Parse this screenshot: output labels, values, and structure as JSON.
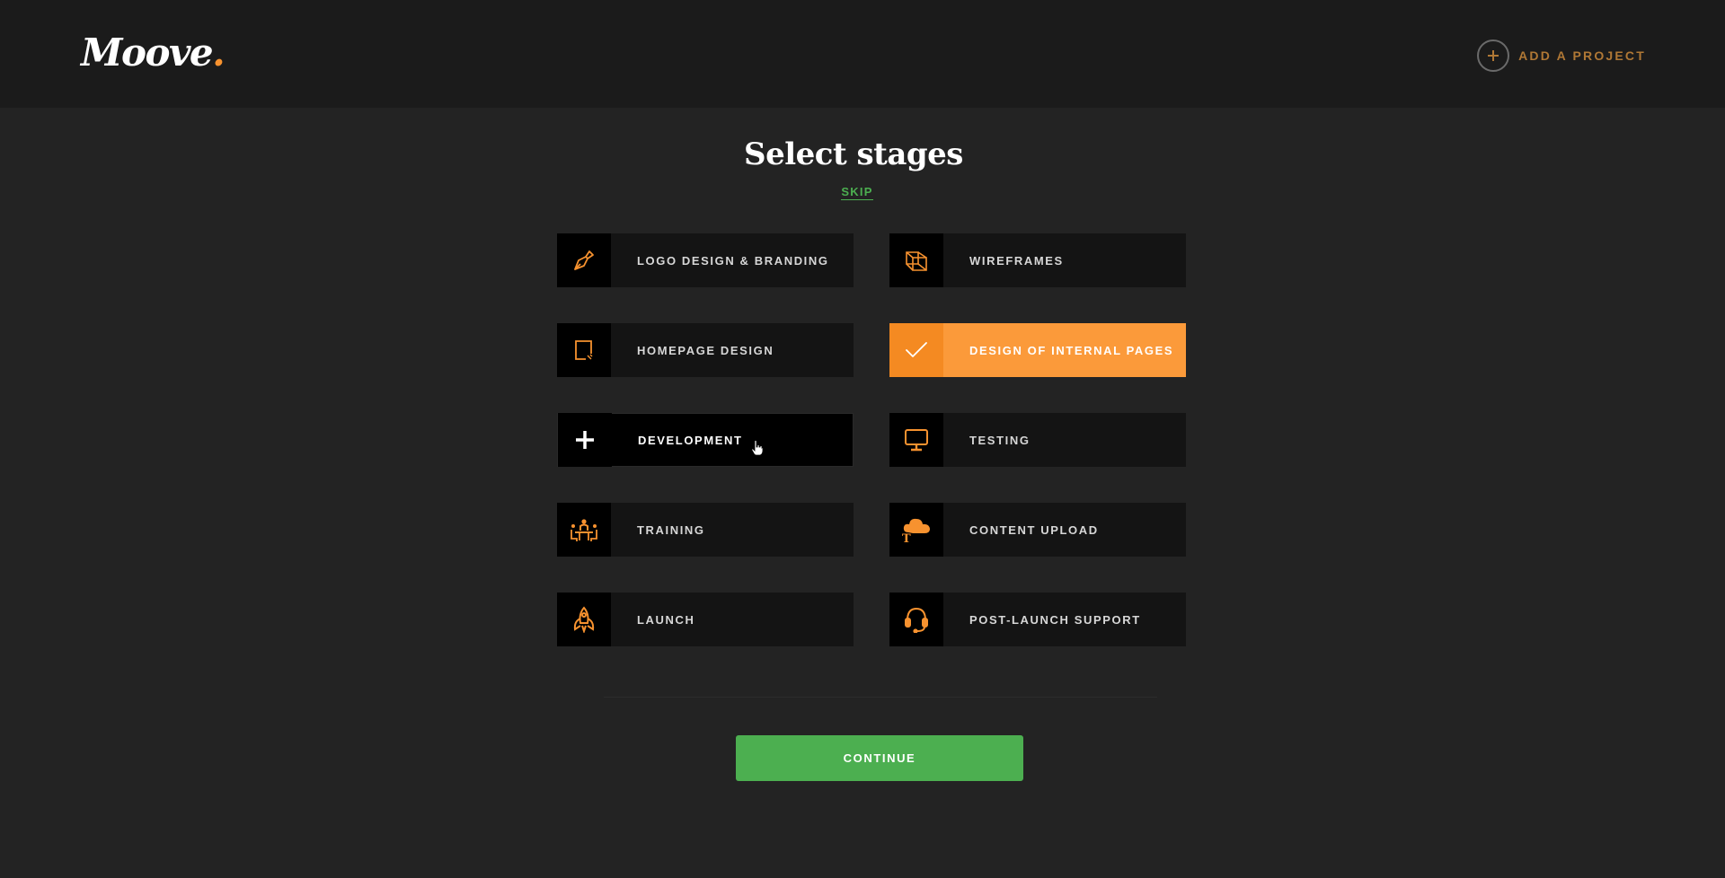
{
  "header": {
    "logo_text": "Moove",
    "logo_dot": ".",
    "add_project_label": "ADD A PROJECT",
    "add_project_icon": "plus-circle-icon"
  },
  "page": {
    "title": "Select stages",
    "skip_label": "SKIP"
  },
  "stages": [
    {
      "label": "LOGO DESIGN & BRANDING",
      "icon": "pen-nib-icon",
      "selected": false
    },
    {
      "label": "WIREFRAMES",
      "icon": "cube-wireframe-icon",
      "selected": false
    },
    {
      "label": "HOMEPAGE DESIGN",
      "icon": "tablet-pencil-icon",
      "selected": false
    },
    {
      "label": "DESIGN OF INTERNAL PAGES",
      "icon": "checkmark-icon",
      "selected": true
    },
    {
      "label": "DEVELOPMENT",
      "icon": "plus-icon",
      "selected": false,
      "hovered": true
    },
    {
      "label": "TESTING",
      "icon": "monitor-icon",
      "selected": false
    },
    {
      "label": "TRAINING",
      "icon": "meeting-table-icon",
      "selected": false
    },
    {
      "label": "CONTENT UPLOAD",
      "icon": "cloud-text-icon",
      "selected": false
    },
    {
      "label": "LAUNCH",
      "icon": "rocket-icon",
      "selected": false
    },
    {
      "label": "POST-LAUNCH SUPPORT",
      "icon": "headset-icon",
      "selected": false
    }
  ],
  "footer": {
    "continue_label": "CONTINUE"
  },
  "colors": {
    "accent": "#f7922f",
    "selected": "#fb9a3a",
    "primary_button": "#4caf50",
    "background": "#232323",
    "header": "#1b1b1b"
  }
}
